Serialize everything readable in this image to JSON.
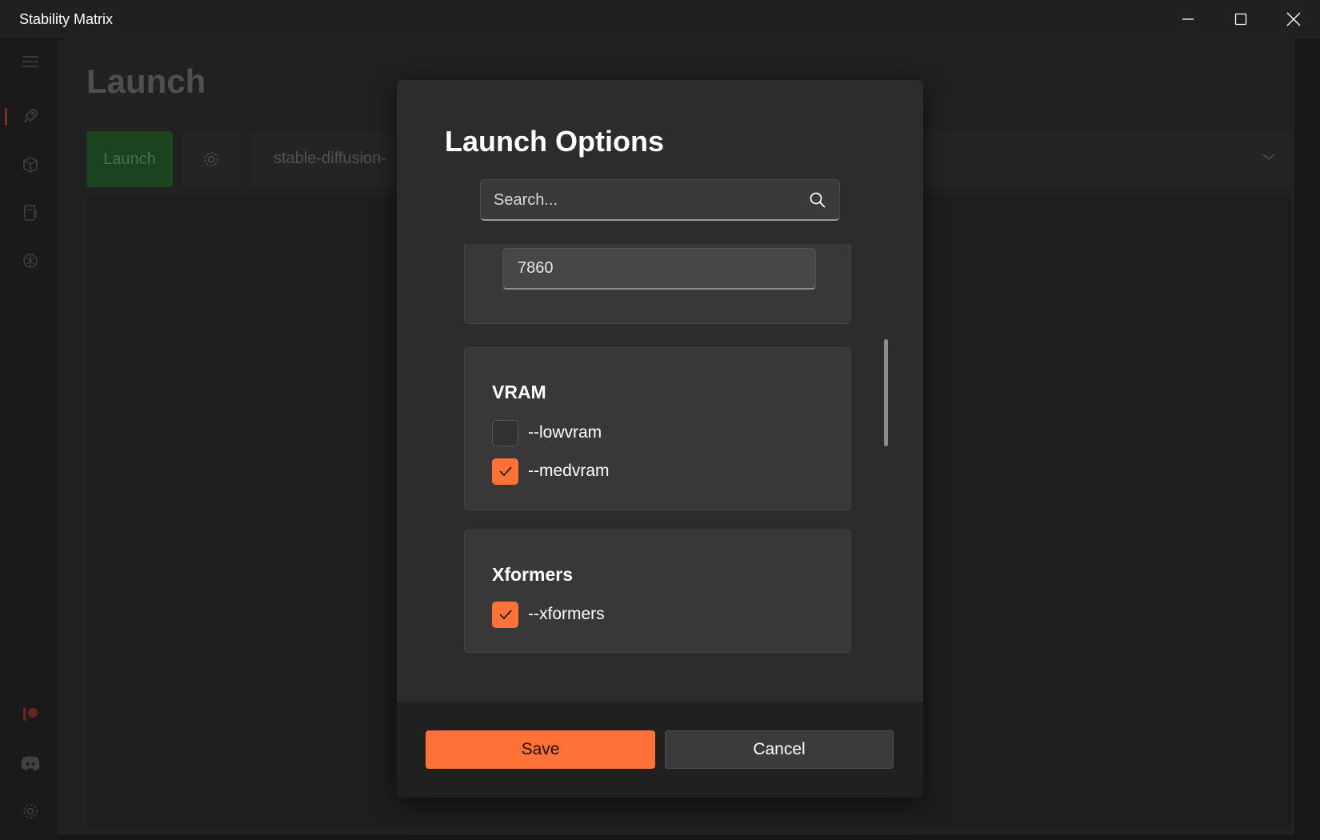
{
  "window": {
    "title": "Stability Matrix"
  },
  "sidebar": {
    "items": [
      {
        "icon": "menu-icon"
      },
      {
        "icon": "rocket-icon",
        "selected": true
      },
      {
        "icon": "package-icon"
      },
      {
        "icon": "checkpoints-icon"
      },
      {
        "icon": "model-browser-icon"
      }
    ],
    "footer_items": [
      {
        "icon": "patreon-icon"
      },
      {
        "icon": "discord-icon"
      },
      {
        "icon": "settings-icon"
      }
    ]
  },
  "page": {
    "title": "Launch",
    "launch_button": "Launch",
    "package_selected": "stable-diffusion-"
  },
  "dialog": {
    "title": "Launch Options",
    "search_placeholder": "Search...",
    "port_value": "7860",
    "sections": [
      {
        "title": "VRAM",
        "options": [
          {
            "label": "--lowvram",
            "checked": false
          },
          {
            "label": "--medvram",
            "checked": true
          }
        ]
      },
      {
        "title": "Xformers",
        "options": [
          {
            "label": "--xformers",
            "checked": true
          }
        ]
      }
    ],
    "save_label": "Save",
    "cancel_label": "Cancel"
  },
  "colors": {
    "accent": "#ff7137",
    "launch_green": "#1f4d24",
    "dialog_bg": "#2c2c2c",
    "card_bg": "#383838"
  }
}
